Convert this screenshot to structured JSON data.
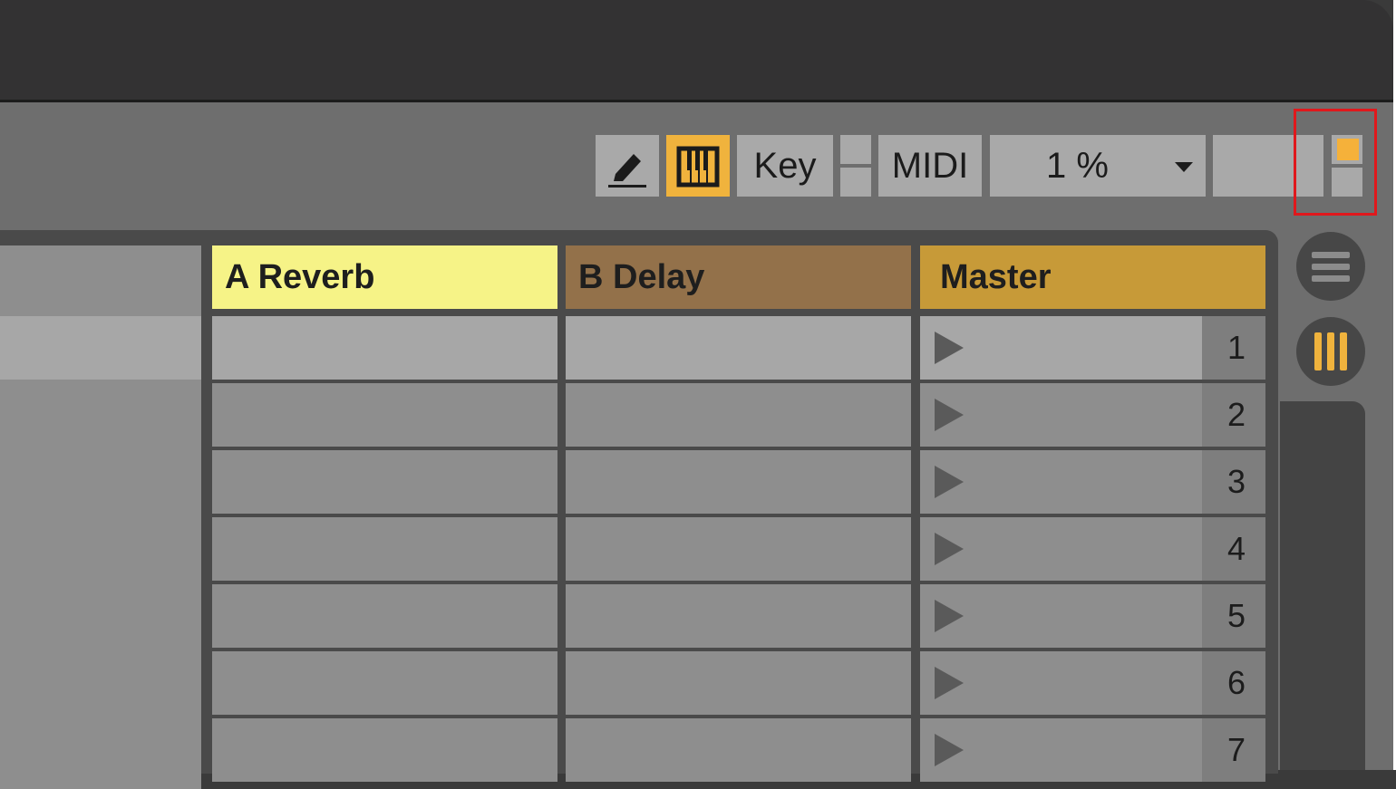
{
  "toolbar": {
    "draw_mode": "draw-mode",
    "keys": "keys",
    "key_label": "Key",
    "midi_label": "MIDI",
    "cpu_label": "1 %"
  },
  "tracks": [
    {
      "name": "A Reverb",
      "color": "#f6f387"
    },
    {
      "name": "B Delay",
      "color": "#93714a"
    },
    {
      "name": "Master",
      "color": "#c79a38"
    }
  ],
  "scenes": [
    "1",
    "2",
    "3",
    "4",
    "5",
    "6",
    "7"
  ],
  "colors": {
    "accent": "#f0b33d",
    "highlight": "#e0181c"
  }
}
